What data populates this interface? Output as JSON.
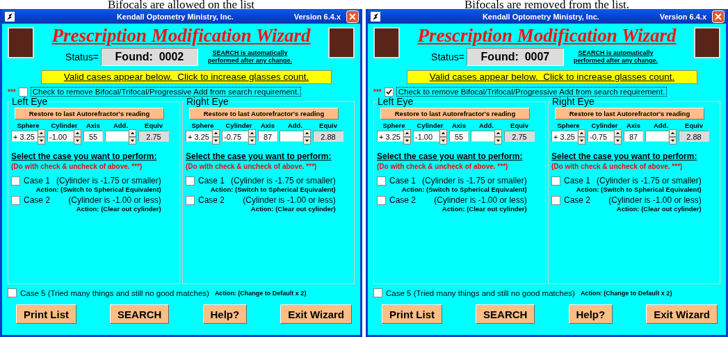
{
  "panels": [
    {
      "caption": "Bifocals are allowed on the list",
      "title_bar": {
        "title": "Kendall Optometry Ministry, Inc.",
        "version": "Version 6.4.x"
      },
      "heading": "Prescription Modification Wizard",
      "status": {
        "label": "Status=",
        "value": "Found:  0002"
      },
      "search_note": "SEARCH is automatically performed after any change.",
      "banner": "Valid cases appear below.  Click to increase glasses count.",
      "remove_add": {
        "marker": "***",
        "label": "Check to remove Bifocal/Trifocal/Progressive Add from search requirement.",
        "checked": false
      },
      "eyes": [
        {
          "title": "Left Eye",
          "restore_button": "Restore to last Autorefractor's reading",
          "fields": [
            {
              "label": "Sphere",
              "value": "+ 3.25",
              "kind": "spin"
            },
            {
              "label": "Cylinder",
              "value": "-1.00",
              "kind": "spin"
            },
            {
              "label": "Axis",
              "value": "55",
              "kind": "plain"
            },
            {
              "label": "Add.",
              "kind": "spin"
            },
            {
              "label": "Equiv",
              "value": "2.75",
              "kind": "readonly"
            }
          ],
          "instruction": "Select the case you want to perform:",
          "note": "(Do with check & uncheck of above. ***)",
          "cases": [
            {
              "label": "Case 1",
              "condition": "(Cylinder is -1.75 or smaller)",
              "action": "Action: (Switch to Spherical Equivalent)",
              "checked": false
            },
            {
              "label": "Case 2",
              "condition": "(Cylinder is -1.00 or less)",
              "action": "Action:  (Clear out cylinder)",
              "checked": false
            }
          ]
        },
        {
          "title": "Right Eye",
          "restore_button": "Restore to last Autorefractor's reading",
          "fields": [
            {
              "label": "Sphere",
              "value": "+ 3.25",
              "kind": "spin"
            },
            {
              "label": "Cylinder",
              "value": "-0.75",
              "kind": "spin"
            },
            {
              "label": "Axis",
              "value": "87",
              "kind": "plain"
            },
            {
              "label": "Add.",
              "kind": "spin"
            },
            {
              "label": "Equiv",
              "value": "2.88",
              "kind": "readonly"
            }
          ],
          "instruction": "Select the case you want to perform:",
          "note": "(Do with check & uncheck of above. ***)",
          "cases": [
            {
              "label": "Case 1",
              "condition": "(Cylinder is -1.75 or smaller)",
              "action": "Action: (Switch to Spherical Equivalent)",
              "checked": false
            },
            {
              "label": "Case 2",
              "condition": "(Cylinder is -1.00 or less)",
              "action": "Action:  (Clear out cylinder)",
              "checked": false
            }
          ]
        }
      ],
      "case5": {
        "label": "Case 5 (Tried many things and still no good matches)",
        "action": "Action:  (Change to Default x 2)",
        "checked": false
      },
      "buttons": [
        "Print List",
        "SEARCH",
        "Help?",
        "Exit Wizard"
      ]
    },
    {
      "caption": "Bifocals are removed from the list.",
      "title_bar": {
        "title": "Kendall Optometry Ministry, Inc.",
        "version": "Version 6.4.x"
      },
      "heading": "Prescription Modification Wizard",
      "status": {
        "label": "Status=",
        "value": "Found:  0007"
      },
      "search_note": "SEARCH is automatically performed after any change.",
      "banner": "Valid cases appear below.  Click to increase glasses count.",
      "remove_add": {
        "marker": "***",
        "label": "Check to remove Bifocal/Trifocal/Progressive Add from search requirement.",
        "checked": true
      },
      "eyes": [
        {
          "title": "Left Eye",
          "restore_button": "Restore to last Autorefractor's reading",
          "fields": [
            {
              "label": "Sphere",
              "value": "+ 3.25",
              "kind": "spin"
            },
            {
              "label": "Cylinder",
              "value": "-1.00",
              "kind": "spin"
            },
            {
              "label": "Axis",
              "value": "55",
              "kind": "plain"
            },
            {
              "label": "Add.",
              "kind": "spin"
            },
            {
              "label": "Equiv",
              "value": "2.75",
              "kind": "readonly"
            }
          ],
          "instruction": "Select the case you want to perform:",
          "note": "(Do with check & uncheck of above. ***)",
          "cases": [
            {
              "label": "Case 1",
              "condition": "(Cylinder is -1.75 or smaller)",
              "action": "Action: (Switch to Spherical Equivalent)",
              "checked": false
            },
            {
              "label": "Case 2",
              "condition": "(Cylinder is -1.00 or less)",
              "action": "Action:  (Clear out cylinder)",
              "checked": false
            }
          ]
        },
        {
          "title": "Right Eye",
          "restore_button": "Restore to last Autorefractor's reading",
          "fields": [
            {
              "label": "Sphere",
              "value": "+ 3.25",
              "kind": "spin"
            },
            {
              "label": "Cylinder",
              "value": "-0.75",
              "kind": "spin"
            },
            {
              "label": "Axis",
              "value": "87",
              "kind": "plain"
            },
            {
              "label": "Add.",
              "kind": "spin"
            },
            {
              "label": "Equiv",
              "value": "2.88",
              "kind": "readonly"
            }
          ],
          "instruction": "Select the case you want to perform:",
          "note": "(Do with check & uncheck of above. ***)",
          "cases": [
            {
              "label": "Case 1",
              "condition": "(Cylinder is -1.75 or smaller)",
              "action": "Action: (Switch to Spherical Equivalent)",
              "checked": false
            },
            {
              "label": "Case 2",
              "condition": "(Cylinder is -1.00 or less)",
              "action": "Action:  (Clear out cylinder)",
              "checked": false
            }
          ]
        }
      ],
      "case5": {
        "label": "Case 5 (Tried many things and still no good matches)",
        "action": "Action:  (Change to Default x 2)",
        "checked": false
      },
      "buttons": [
        "Print List",
        "SEARCH",
        "Help?",
        "Exit Wizard"
      ]
    }
  ]
}
